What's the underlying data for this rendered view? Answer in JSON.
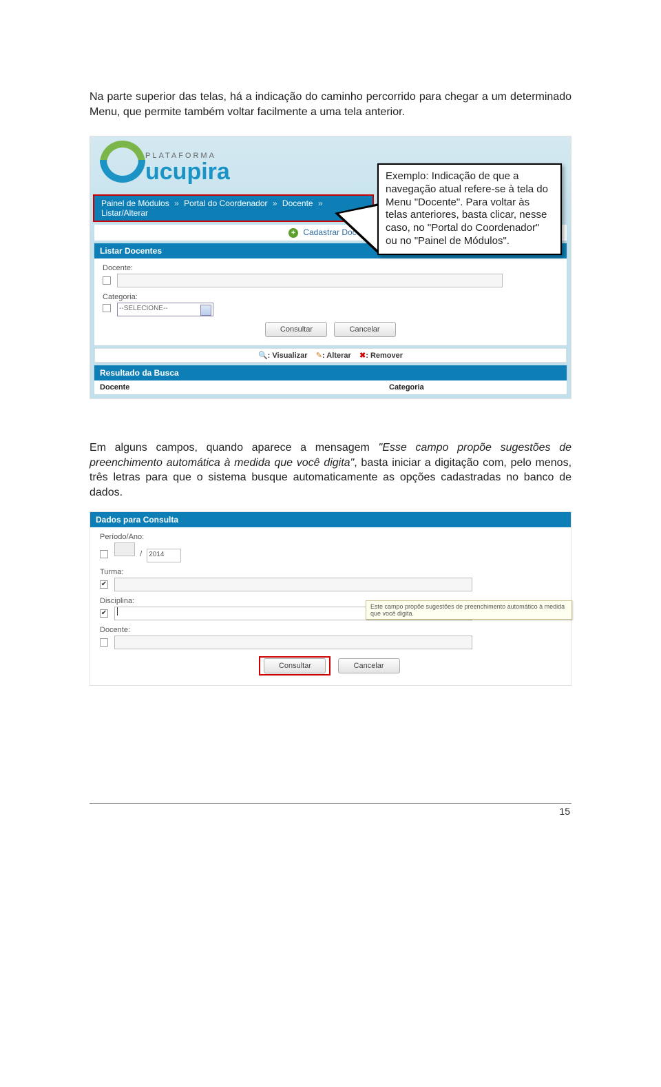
{
  "intro": "Na parte superior das telas, há a indicação do caminho percorrido para chegar a um determinado Menu, que permite também voltar facilmente a uma tela anterior.",
  "logo": {
    "platform": "PLATAFORMA",
    "name": "ucupira"
  },
  "breadcrumb": {
    "items": [
      "Painel de Módulos",
      "Portal do Coordenador",
      "Docente",
      "Listar/Alterar"
    ],
    "sep": "»"
  },
  "cadastrar": "Cadastrar Docente",
  "section1": "Listar Docentes",
  "form1": {
    "docente_label": "Docente:",
    "categoria_label": "Categoria:",
    "categoria_placeholder": "--SELECIONE--",
    "consultar": "Consultar",
    "cancelar": "Cancelar"
  },
  "legend": {
    "visualizar": ": Visualizar",
    "alterar": ": Alterar",
    "remover": ": Remover"
  },
  "result_head": "Resultado da Busca",
  "cols": {
    "c1": "Docente",
    "c2": "Categoria"
  },
  "callout": "Exemplo: Indicação de que a navegação atual refere-se à tela do Menu \"Docente\". Para voltar às telas anteriores, basta clicar, nesse caso, no \"Portal do Coordenador\" ou no \"Painel de Módulos\".",
  "para2_a": "Em alguns campos, quando aparece a mensagem ",
  "para2_i": "\"Esse campo propõe sugestões de preenchimento automática à medida que você digita\"",
  "para2_b": ", basta iniciar a digitação com, pelo menos, três letras para que o sistema busque automaticamente as opções cadastradas no banco de dados.",
  "section2": "Dados para Consulta",
  "form2": {
    "periodo_label": "Período/Ano:",
    "periodo_year": "2014",
    "turma_label": "Turma:",
    "disciplina_label": "Disciplina:",
    "docente_label": "Docente:",
    "consultar": "Consultar",
    "cancelar": "Cancelar"
  },
  "tooltip": "Este campo propõe sugestões de preenchimento automático à medida que você digita.",
  "pagenum": "15"
}
